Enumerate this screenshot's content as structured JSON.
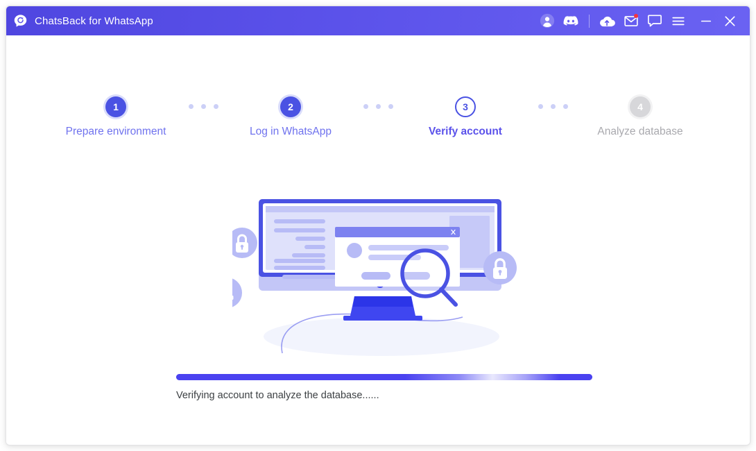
{
  "window": {
    "title": "ChatsBack for WhatsApp",
    "logo_icon": "chat-bubble-refresh-logo"
  },
  "titlebar": {
    "actions": [
      {
        "name": "account-icon",
        "label": "Account"
      },
      {
        "name": "discord-icon",
        "label": "Discord"
      },
      {
        "name": "cloud-icon",
        "label": "Cloud"
      },
      {
        "name": "mail-icon",
        "label": "Messages"
      },
      {
        "name": "feedback-icon",
        "label": "Feedback"
      },
      {
        "name": "menu-icon",
        "label": "Menu"
      },
      {
        "name": "minimize-icon",
        "label": "Minimize"
      },
      {
        "name": "close-icon",
        "label": "Close"
      }
    ]
  },
  "stepper": {
    "steps": [
      {
        "number": "1",
        "label": "Prepare environment",
        "state": "done"
      },
      {
        "number": "2",
        "label": "Log in WhatsApp",
        "state": "done"
      },
      {
        "number": "3",
        "label": "Verify account",
        "state": "active"
      },
      {
        "number": "4",
        "label": "Analyze database",
        "state": "pending"
      }
    ]
  },
  "illustration": {
    "name": "monitor-search-illustration",
    "badges": [
      {
        "name": "lock-icon",
        "label": "Lock"
      },
      {
        "name": "bar-chart-icon",
        "label": "Statistics"
      },
      {
        "name": "lock-icon",
        "label": "Lock"
      }
    ],
    "magnifier_icon": "magnifying-glass-icon",
    "dialog_close_icon": "dialog-close-icon"
  },
  "progress": {
    "status_text": "Verifying account to analyze the database......",
    "percent": 100
  },
  "colors": {
    "brand_primary": "#4a52e3",
    "brand_header_left": "#4f46e0",
    "brand_header_right": "#6a62f2",
    "progress_fill": "#4a42f0",
    "step_pending": "#d7d7da",
    "step_done_label": "#6f72ee",
    "status_text": "#3c4043",
    "notification_dot": "#f5333f"
  }
}
